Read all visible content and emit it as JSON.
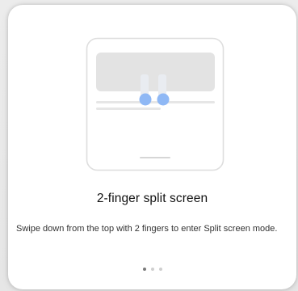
{
  "card": {
    "title": "2-finger split screen",
    "description": "Swipe down from the top with 2 fingers to enter Split screen mode."
  },
  "illustration": {
    "icon": "phone-split-screen-gesture-illustration",
    "touch_point_color": "#8fb8f5"
  },
  "pagination": {
    "count": 3,
    "active_index": 0
  },
  "colors": {
    "card_background": "#ffffff",
    "backdrop": "#e9e9e9",
    "title": "#111111",
    "description": "#333333"
  }
}
